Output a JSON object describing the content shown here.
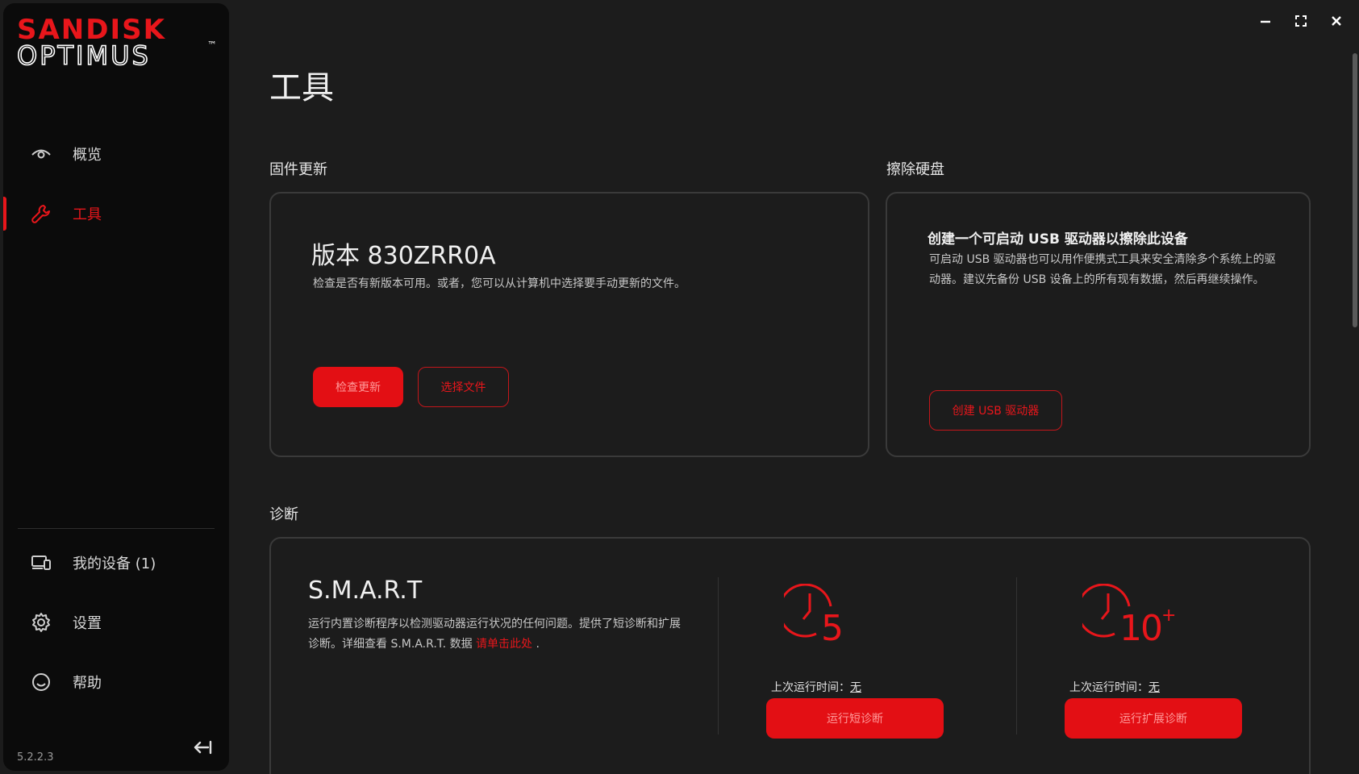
{
  "brand": {
    "line1": "SANDISK",
    "line2": "OPTIMUS",
    "tm": "™",
    "color": "#e8161b"
  },
  "sidebar": {
    "items": [
      {
        "label": "概览",
        "icon": "eye-icon"
      },
      {
        "label": "工具",
        "icon": "wrench-icon",
        "active": true
      }
    ],
    "bottom_items": [
      {
        "label": "我的设备 (1)",
        "icon": "devices-icon"
      },
      {
        "label": "设置",
        "icon": "gear-icon"
      },
      {
        "label": "帮助",
        "icon": "smiley-icon"
      }
    ],
    "version": "5.2.2.3",
    "collapse_icon": "collapse-arrow-icon"
  },
  "window_controls": [
    "minimize-icon",
    "maximize-icon",
    "close-icon"
  ],
  "main": {
    "title": "工具",
    "firmware": {
      "section_title": "固件更新",
      "version": "版本 830ZRR0A",
      "description": "检查是否有新版本可用。或者，您可以从计算机中选择要手动更新的文件。",
      "check_button": "检查更新",
      "choose_button": "选择文件"
    },
    "wipe": {
      "section_title": "擦除硬盘",
      "heading": "创建一个可启动 USB 驱动器以擦除此设备",
      "description": "可启动 USB 驱动器也可以用作便携式工具来安全清除多个系统上的驱动器。建议先备份 USB 设备上的所有现有数据，然后再继续操作。",
      "button": "创建 USB 驱动器"
    },
    "diagnostics": {
      "section_title": "诊断",
      "smart_title": "S.M.A.R.T",
      "description_1": "运行内置诊断程序以检测驱动器运行状况的任何问题。提供了短诊断和扩展诊断。详细查看 S.M.A.R.T. 数据",
      "link": "请单击此处",
      "description_end": ".",
      "short": {
        "icon_number": "5",
        "last_run_label": "上次运行时间：",
        "last_run_value": "无",
        "button": "运行短诊断"
      },
      "extended": {
        "icon_number": "10",
        "icon_suffix": "+",
        "last_run_label": "上次运行时间：",
        "last_run_value": "无",
        "button": "运行扩展诊断"
      }
    }
  }
}
